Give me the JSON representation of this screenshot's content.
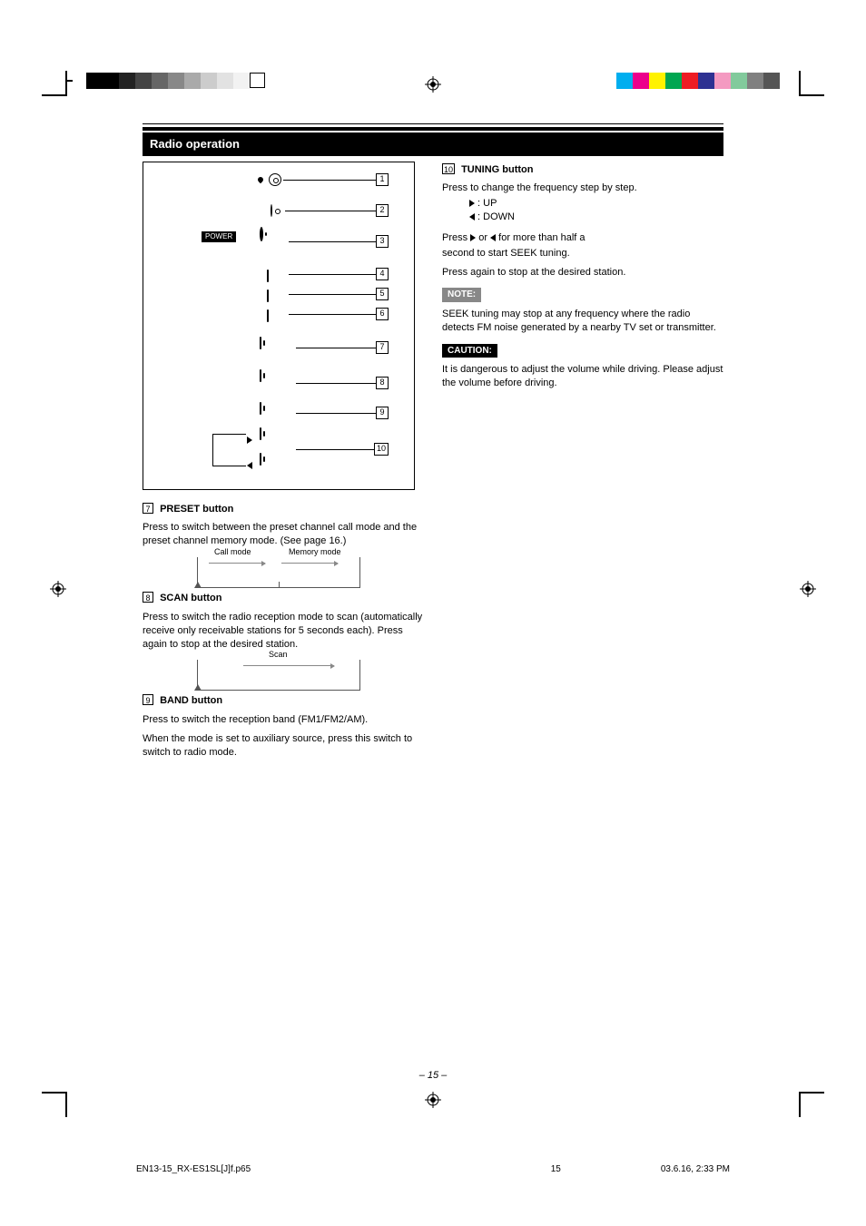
{
  "title": "Radio operation",
  "diagram": {
    "callouts": [
      "1",
      "2",
      "3",
      "4",
      "5",
      "6",
      "7",
      "8",
      "9",
      "10"
    ],
    "power_label": "POWER",
    "tuning_up": "▶",
    "tuning_down": "◀"
  },
  "left": {
    "item7_num": "7",
    "item7_head": "PRESET button",
    "item7_body": "Press to switch between the preset channel call mode and the preset channel memory mode. (See page 16.)",
    "diag7_labels": {
      "call": "Call mode",
      "memory": "Memory mode"
    },
    "item8_num": "8",
    "item8_head": "SCAN button",
    "item8_body": "Press to switch the radio reception mode to scan (automatically receive only receivable stations for 5 seconds each). Press again to stop at the desired station.",
    "diag8_labels": {
      "scan": "Scan"
    },
    "item9_num": "9",
    "item9_head": "BAND button",
    "item9_body": "Press to switch the reception band (FM1/FM2/AM).",
    "item9_note": "When the mode is set to auxiliary source, press this switch to switch to radio mode."
  },
  "right": {
    "item10_num": "10",
    "item10_head": "TUNING button",
    "item10_a": "Press to change the frequency step by step.",
    "item10_a_sub1": " : UP",
    "item10_a_sub2": " : DOWN",
    "item10_b_pre": "Press",
    "item10_b_mid1": "or",
    "item10_b_mid2": "for more than half a",
    "item10_b_line2": "second to start SEEK tuning.",
    "item10_b_line3": "Press again to stop at the desired station.",
    "note_label": "NOTE:",
    "note_body": "SEEK tuning may stop at any frequency where the radio detects FM noise generated by a nearby TV set or transmitter.",
    "caution_label": "CAUTION:",
    "caution_body": "It is dangerous to adjust the volume while driving. Please adjust the volume before driving."
  },
  "footer": {
    "page_num": "– 15 –",
    "file": "EN13-15_RX-ES1SL[J]f.p65",
    "meta": "03.6.16, 2:33 PM",
    "meta_page": "15"
  }
}
